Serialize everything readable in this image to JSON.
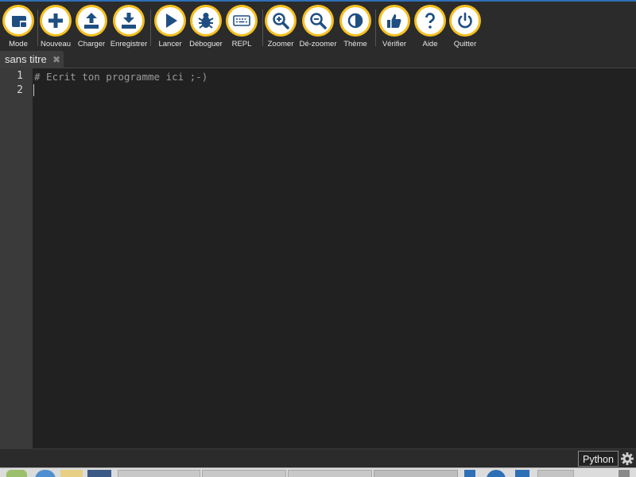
{
  "toolbar": {
    "buttons": [
      {
        "label": "Mode",
        "icon": "mode-icon"
      },
      {
        "label": "Nouveau",
        "icon": "plus-icon"
      },
      {
        "label": "Charger",
        "icon": "upload-icon"
      },
      {
        "label": "Enregistrer",
        "icon": "download-icon"
      },
      {
        "label": "Lancer",
        "icon": "play-icon"
      },
      {
        "label": "Déboguer",
        "icon": "bug-icon"
      },
      {
        "label": "REPL",
        "icon": "keyboard-icon"
      },
      {
        "label": "Zoomer",
        "icon": "zoom-in-icon"
      },
      {
        "label": "Dé-zoomer",
        "icon": "zoom-out-icon"
      },
      {
        "label": "Thème",
        "icon": "theme-icon"
      },
      {
        "label": "Vérifier",
        "icon": "thumbs-up-icon"
      },
      {
        "label": "Aide",
        "icon": "help-icon"
      },
      {
        "label": "Quitter",
        "icon": "power-icon"
      }
    ],
    "accent_color": "#f5bf1f",
    "icon_color": "#1f4f82"
  },
  "tabs": [
    {
      "title": "sans titre",
      "close_icon": "close-icon",
      "active": true
    }
  ],
  "editor": {
    "line_numbers": [
      "1",
      "2"
    ],
    "lines": [
      "# Ecrit ton programme ici ;-)",
      ""
    ]
  },
  "statusbar": {
    "mode": "Python",
    "settings_icon": "gear-icon"
  }
}
